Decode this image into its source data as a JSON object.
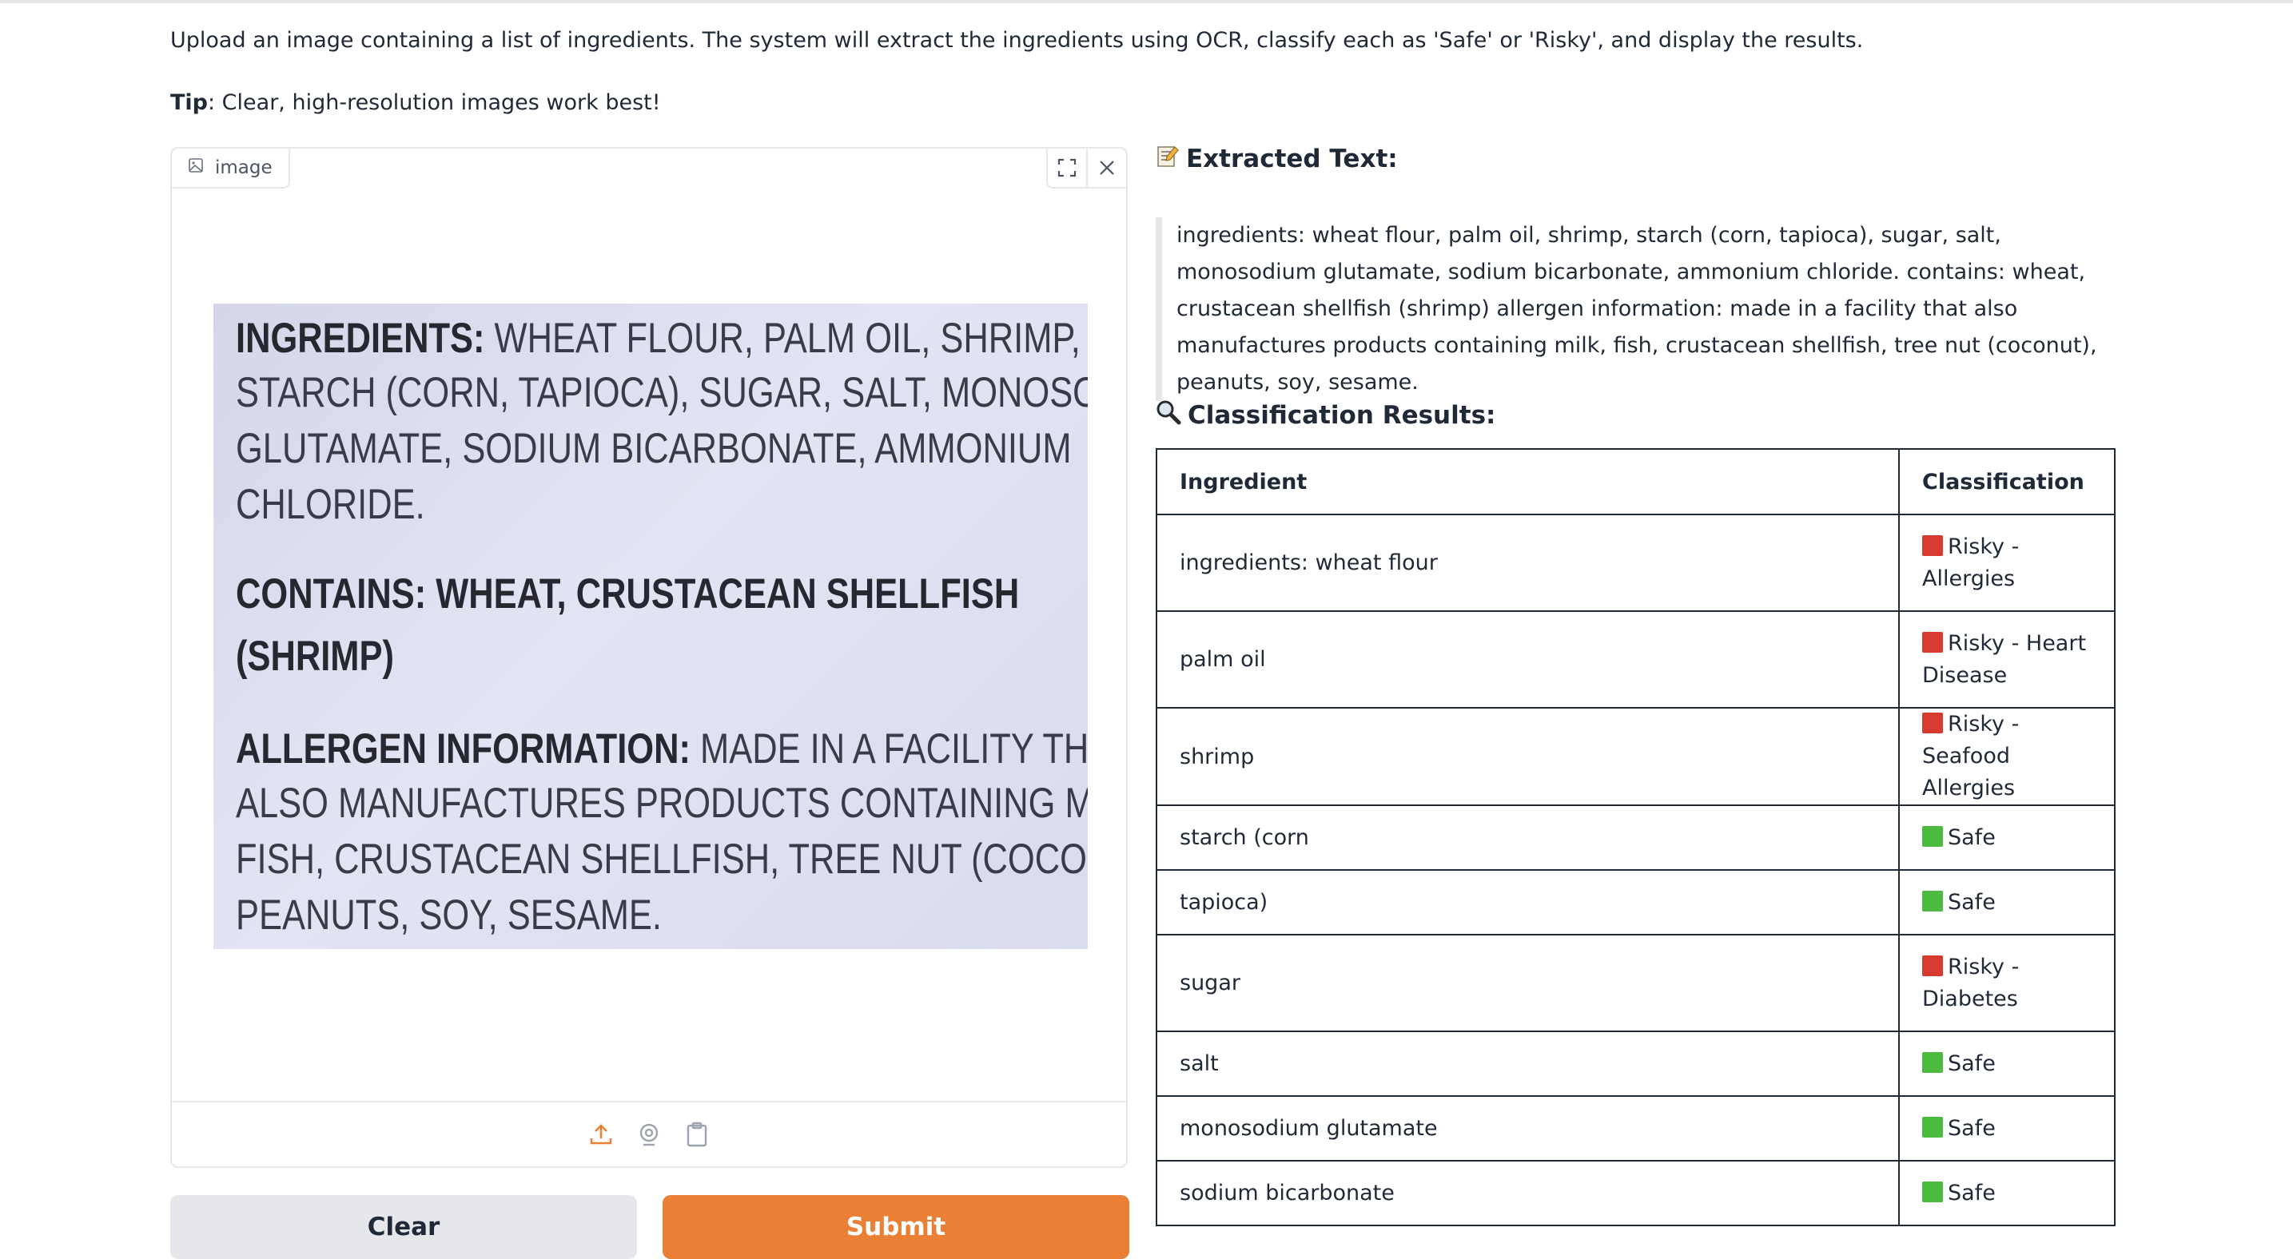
{
  "description": "Upload an image containing a list of ingredients. The system will extract the ingredients using OCR, classify each as 'Safe' or 'Risky', and display the results.",
  "tip": {
    "label": "Tip",
    "text": ": Clear, high-resolution images work best!"
  },
  "image_panel": {
    "label": "image",
    "photo_lines": [
      {
        "bold": "INGREDIENTS:",
        "text": " WHEAT FLOUR, PALM OIL, SHRIMP,"
      },
      {
        "bold": "",
        "text": "STARCH (CORN, TAPIOCA), SUGAR, SALT, MONOSODIUM"
      },
      {
        "bold": "",
        "text": "GLUTAMATE, SODIUM BICARBONATE, AMMONIUM"
      },
      {
        "bold": "",
        "text": "CHLORIDE."
      },
      {
        "bold": "CONTAINS: WHEAT, CRUSTACEAN SHELLFISH",
        "text": ""
      },
      {
        "bold": "(SHRIMP)",
        "text": ""
      },
      {
        "bold": "ALLERGEN INFORMATION:",
        "text": " MADE IN A FACILITY THAT"
      },
      {
        "bold": "",
        "text": "ALSO MANUFACTURES PRODUCTS CONTAINING MILK,"
      },
      {
        "bold": "",
        "text": "FISH, CRUSTACEAN SHELLFISH, TREE NUT (COCONUT),"
      },
      {
        "bold": "",
        "text": "PEANUTS, SOY, SESAME."
      }
    ]
  },
  "buttons": {
    "clear": "Clear",
    "submit": "Submit"
  },
  "extracted": {
    "heading": "Extracted Text:",
    "text": "ingredients: wheat flour, palm oil, shrimp, starch (corn, tapioca), sugar, salt, monosodium glutamate, sodium bicarbonate, ammonium chloride. contains: wheat, crustacean shellfish (shrimp) allergen information: made in a facility that also manufactures products containing milk, fish, crustacean shellfish, tree nut (coconut), peanuts, soy, sesame."
  },
  "classification": {
    "heading": "Classification Results:",
    "headers": [
      "Ingredient",
      "Classification"
    ],
    "rows": [
      {
        "ingredient": "ingredients: wheat flour",
        "status": "risky",
        "label": "Risky - Allergies"
      },
      {
        "ingredient": "palm oil",
        "status": "risky",
        "label": "Risky - Heart Disease"
      },
      {
        "ingredient": "shrimp",
        "status": "risky",
        "label": "Risky - Seafood Allergies"
      },
      {
        "ingredient": "starch (corn",
        "status": "safe",
        "label": "Safe"
      },
      {
        "ingredient": "tapioca)",
        "status": "safe",
        "label": "Safe"
      },
      {
        "ingredient": "sugar",
        "status": "risky",
        "label": "Risky - Diabetes"
      },
      {
        "ingredient": "salt",
        "status": "safe",
        "label": "Safe"
      },
      {
        "ingredient": "monosodium glutamate",
        "status": "safe",
        "label": "Safe"
      },
      {
        "ingredient": "sodium bicarbonate",
        "status": "safe",
        "label": "Safe"
      }
    ]
  },
  "colors": {
    "accent": "#ea7f36",
    "risky": "#d73a2f",
    "safe": "#4cb93f"
  },
  "icons": {
    "image_label": "image-icon",
    "fullscreen": "fullscreen-icon",
    "close": "close-icon",
    "upload": "upload-icon",
    "webcam": "webcam-icon",
    "clipboard": "clipboard-icon",
    "memo": "memo-emoji-icon",
    "search": "magnifier-emoji-icon"
  }
}
